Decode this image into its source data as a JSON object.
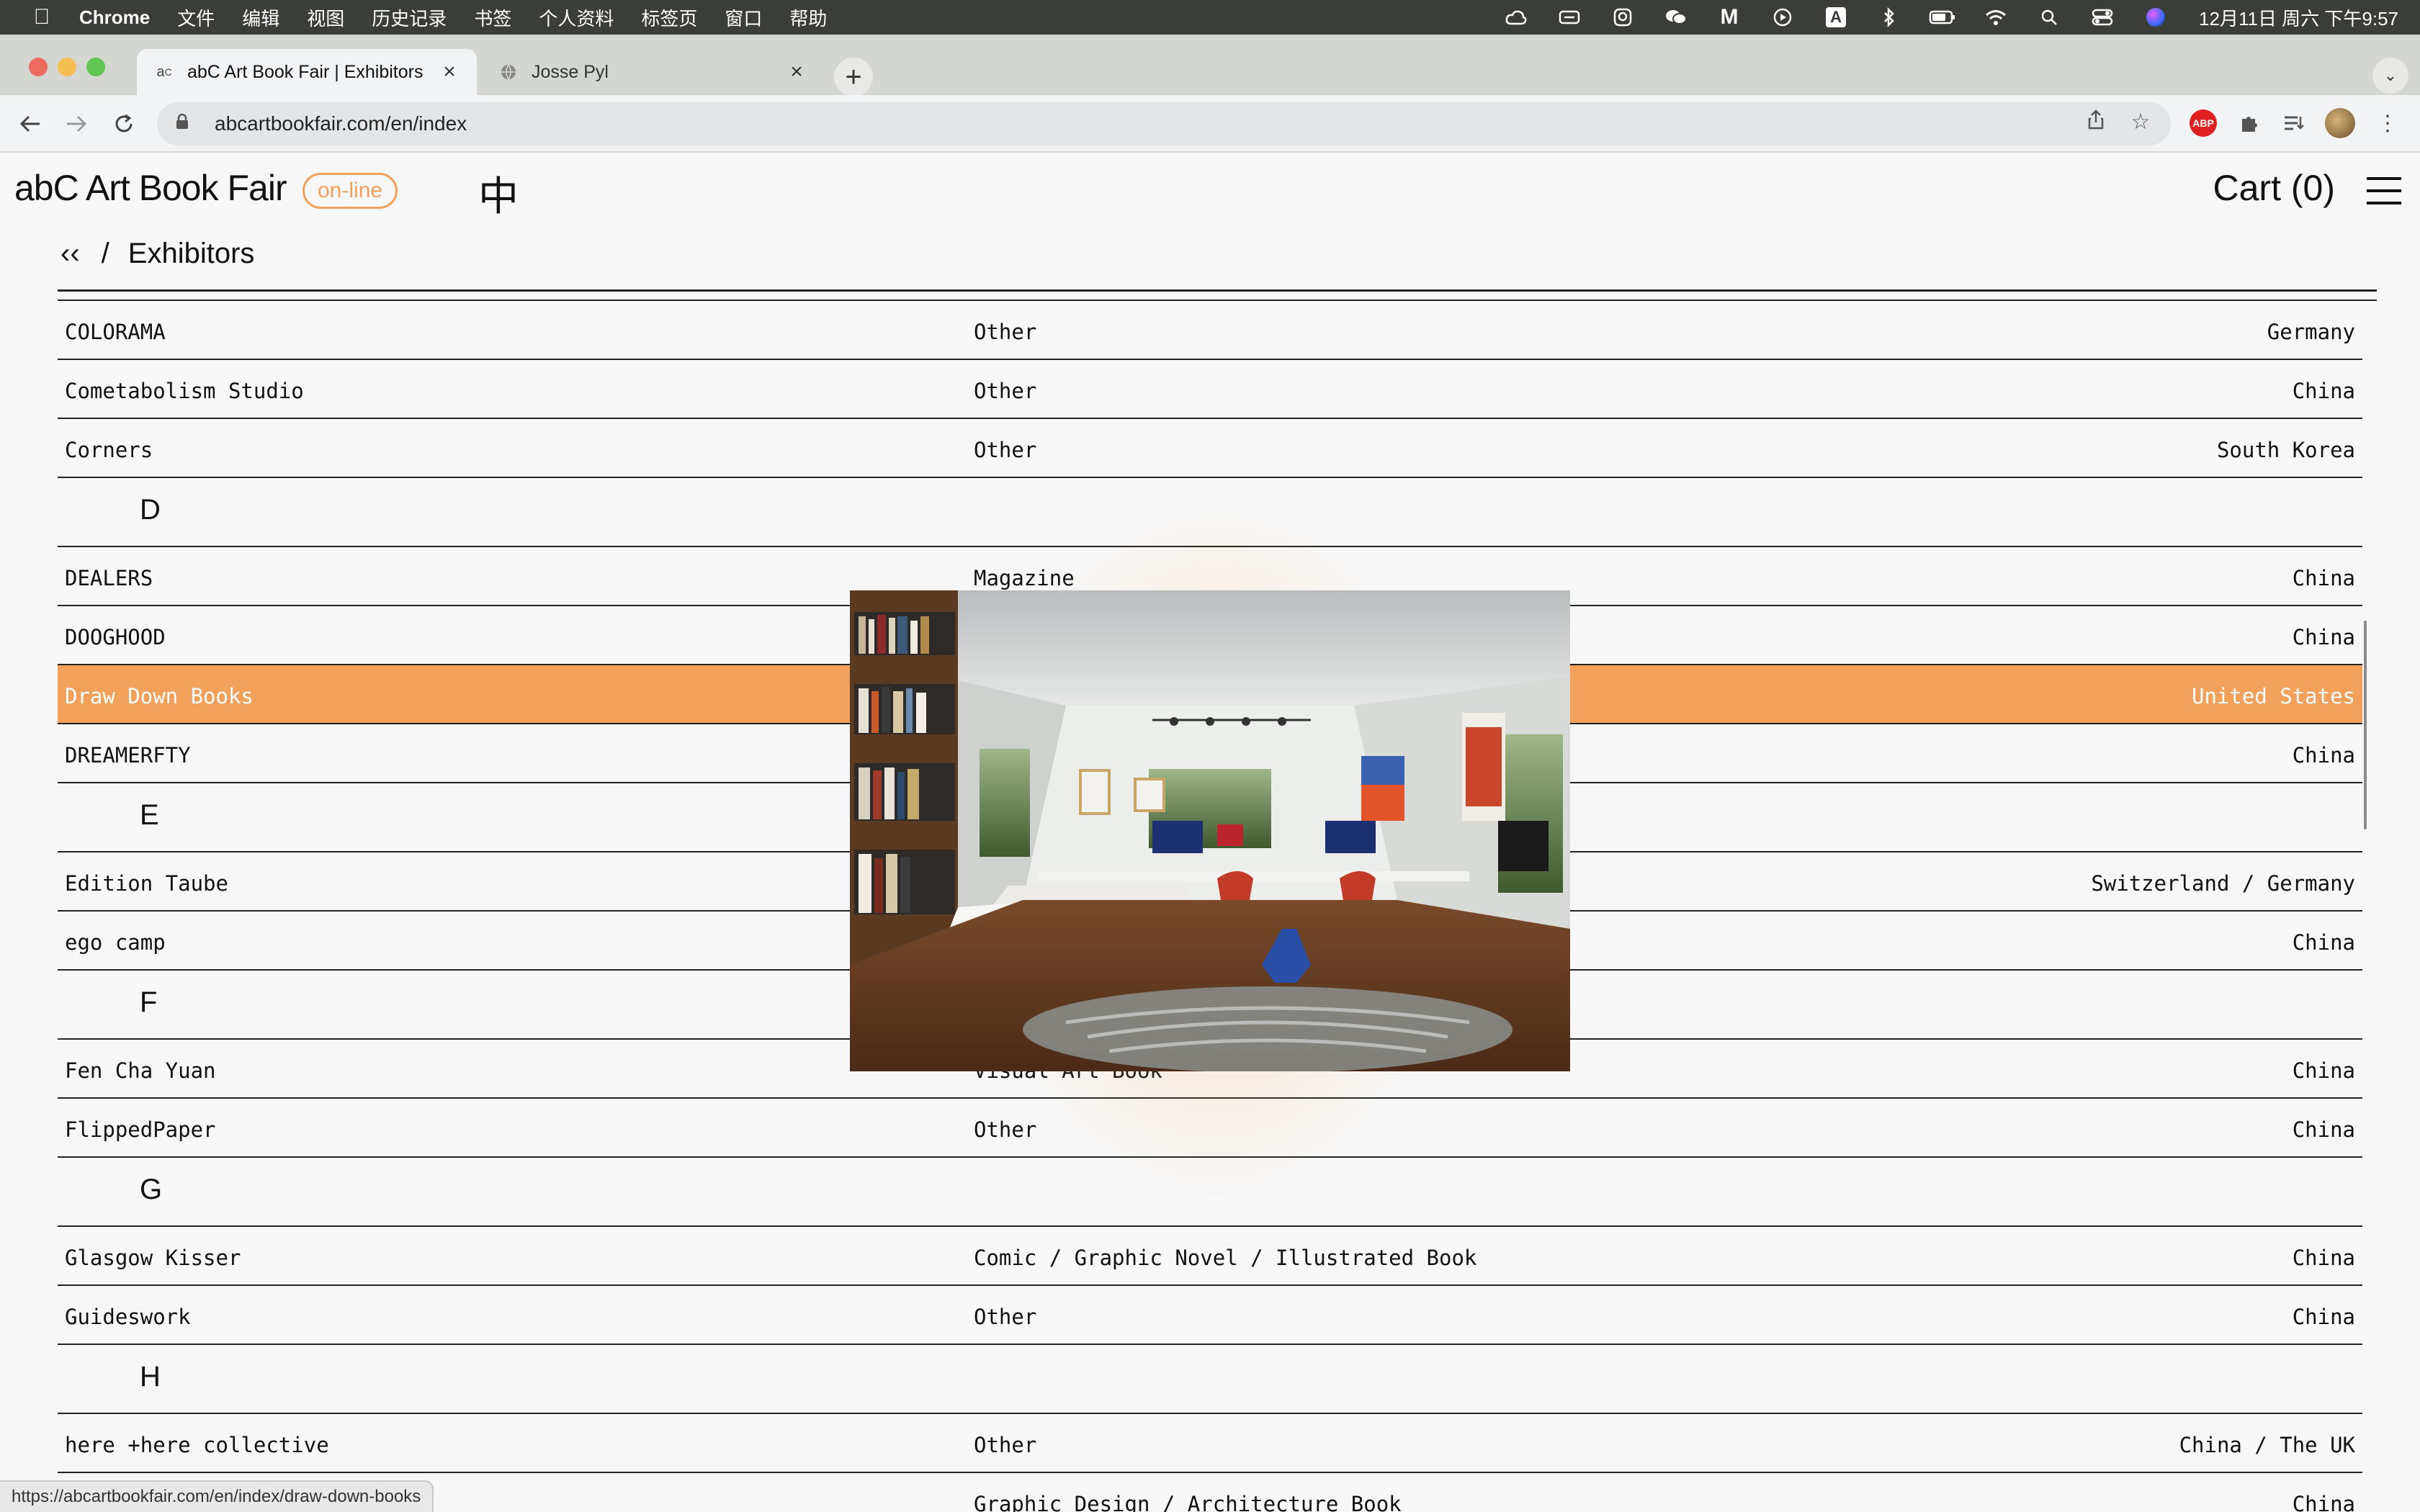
{
  "menubar": {
    "app": "Chrome",
    "items": [
      "文件",
      "编辑",
      "视图",
      "历史记录",
      "书签",
      "个人资料",
      "标签页",
      "窗口",
      "帮助"
    ],
    "clock": "12月11日 周六 下午9:57"
  },
  "tabs": [
    {
      "title": "abC Art Book Fair | Exhibitors",
      "favicon": "abc-favicon"
    },
    {
      "title": "Josse Pyl",
      "favicon": "globe-icon"
    }
  ],
  "toolbar": {
    "url": "abcartbookfair.com/en/index"
  },
  "site": {
    "logo": "abC Art Book Fair",
    "badge": "on-line",
    "lang": "中",
    "cart_label": "Cart",
    "cart_count": "(0)"
  },
  "breadcrumb": {
    "back": "‹‹",
    "separator": "/",
    "current": "Exhibitors"
  },
  "rows": [
    {
      "type": "row",
      "name": "COLORAMA",
      "category": "Other",
      "country": "Germany"
    },
    {
      "type": "row",
      "name": "Cometabolism Studio",
      "category": "Other",
      "country": "China"
    },
    {
      "type": "row",
      "name": "Corners",
      "category": "Other",
      "country": "South Korea"
    },
    {
      "type": "letter",
      "letter": "D"
    },
    {
      "type": "row",
      "name": "DEALERS",
      "category": "Magazine",
      "country": "China"
    },
    {
      "type": "row",
      "name": "DOOGHOOD",
      "category": "",
      "country": "China"
    },
    {
      "type": "row",
      "name": "Draw Down Books",
      "category": "",
      "country": "United States",
      "highlight": true
    },
    {
      "type": "row",
      "name": "DREAMERFTY",
      "category": "",
      "country": "China"
    },
    {
      "type": "letter",
      "letter": "E"
    },
    {
      "type": "row",
      "name": "Edition Taube",
      "category": "",
      "country": "Switzerland / Germany"
    },
    {
      "type": "row",
      "name": "ego camp",
      "category": "",
      "country": "China"
    },
    {
      "type": "letter",
      "letter": "F"
    },
    {
      "type": "row",
      "name": "Fen Cha Yuan",
      "category": "Visual Art Book",
      "country": "China"
    },
    {
      "type": "row",
      "name": "FlippedPaper",
      "category": "Other",
      "country": "China"
    },
    {
      "type": "letter",
      "letter": "G"
    },
    {
      "type": "row",
      "name": "Glasgow Kisser",
      "category": "Comic / Graphic Novel / Illustrated Book",
      "country": "China"
    },
    {
      "type": "row",
      "name": "Guideswork",
      "category": "Other",
      "country": "China"
    },
    {
      "type": "letter",
      "letter": "H"
    },
    {
      "type": "row",
      "name": "here +here collective",
      "category": "Other",
      "country": "China / The UK"
    },
    {
      "type": "row",
      "name": "",
      "category": "Graphic Design / Architecture Book",
      "country": "China"
    }
  ],
  "preview": {
    "icon": "studio-photo"
  },
  "statusbar": {
    "url": "https://abcartbookfair.com/en/index/draw-down-books"
  },
  "colors": {
    "accent": "#f2a05a",
    "menubar": "#3a3d38"
  }
}
